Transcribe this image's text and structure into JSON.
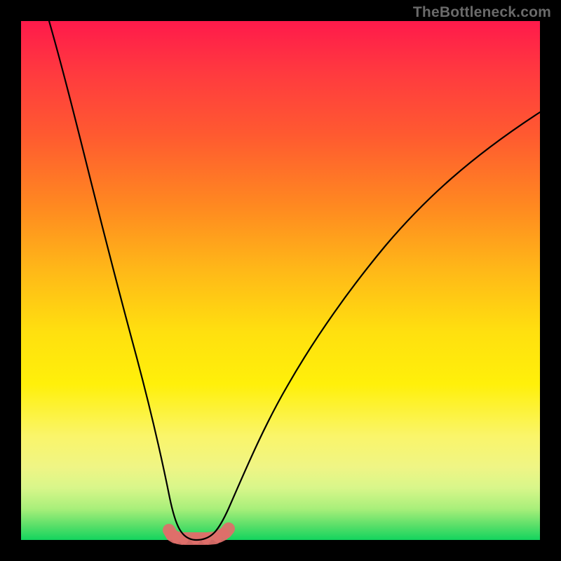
{
  "watermark": "TheBottleneck.com",
  "colors": {
    "background": "#000000",
    "curve": "#000000",
    "marker": "#df6f6b"
  },
  "chart_data": {
    "type": "line",
    "title": "",
    "xlabel": "",
    "ylabel": "",
    "xlim": [
      0,
      1
    ],
    "ylim": [
      0,
      1
    ],
    "x": [
      0.0,
      0.03,
      0.06,
      0.09,
      0.12,
      0.15,
      0.18,
      0.21,
      0.24,
      0.27,
      0.285,
      0.3,
      0.315,
      0.335,
      0.355,
      0.38,
      0.4,
      0.43,
      0.46,
      0.5,
      0.55,
      0.6,
      0.65,
      0.7,
      0.75,
      0.8,
      0.85,
      0.9,
      0.95,
      1.0
    ],
    "values": [
      1.0,
      0.85,
      0.7,
      0.57,
      0.45,
      0.35,
      0.26,
      0.18,
      0.1,
      0.04,
      0.014,
      0.002,
      0.0,
      0.0,
      0.0,
      0.002,
      0.012,
      0.06,
      0.13,
      0.22,
      0.315,
      0.4,
      0.47,
      0.535,
      0.59,
      0.645,
      0.695,
      0.74,
      0.78,
      0.82
    ],
    "highlighted_markers_x": [
      0.285,
      0.3,
      0.315,
      0.335,
      0.355,
      0.38,
      0.395
    ],
    "highlighted_markers_y": [
      0.014,
      0.002,
      0.0,
      0.0,
      0.0,
      0.002,
      0.012
    ],
    "grid": false,
    "legend": false
  }
}
